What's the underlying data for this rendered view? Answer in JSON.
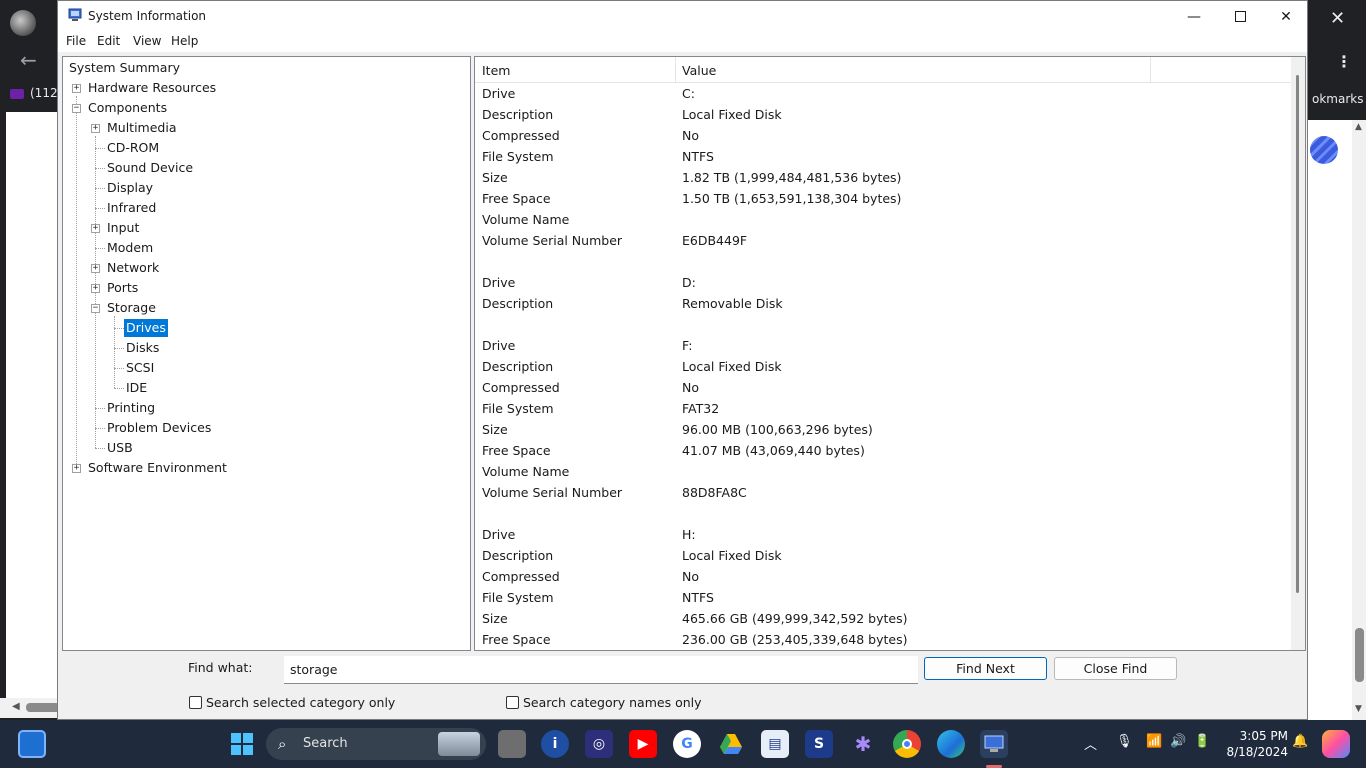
{
  "window": {
    "title": "System Information",
    "minimize": "—",
    "close": "✕"
  },
  "menu": [
    "File",
    "Edit",
    "View",
    "Help"
  ],
  "tree": {
    "system_summary": "System Summary",
    "hardware_resources": "Hardware Resources",
    "components": "Components",
    "multimedia": "Multimedia",
    "cd_rom": "CD-ROM",
    "sound_device": "Sound Device",
    "display": "Display",
    "infrared": "Infrared",
    "input": "Input",
    "modem": "Modem",
    "network": "Network",
    "ports": "Ports",
    "storage": "Storage",
    "drives": "Drives",
    "disks": "Disks",
    "scsi": "SCSI",
    "ide": "IDE",
    "printing": "Printing",
    "problem_devices": "Problem Devices",
    "usb": "USB",
    "software_environment": "Software Environment",
    "expand_sign": "+",
    "collapse_sign": "−"
  },
  "list": {
    "headers": {
      "item": "Item",
      "value": "Value"
    },
    "rows": [
      {
        "item": "Drive",
        "value": "C:"
      },
      {
        "item": "Description",
        "value": "Local Fixed Disk"
      },
      {
        "item": "Compressed",
        "value": "No"
      },
      {
        "item": "File System",
        "value": "NTFS"
      },
      {
        "item": "Size",
        "value": "1.82 TB (1,999,484,481,536 bytes)"
      },
      {
        "item": "Free Space",
        "value": "1.50 TB (1,653,591,138,304 bytes)"
      },
      {
        "item": "Volume Name",
        "value": ""
      },
      {
        "item": "Volume Serial Number",
        "value": "E6DB449F"
      },
      {
        "item": "",
        "value": ""
      },
      {
        "item": "Drive",
        "value": "D:"
      },
      {
        "item": "Description",
        "value": "Removable Disk"
      },
      {
        "item": "",
        "value": ""
      },
      {
        "item": "Drive",
        "value": "F:"
      },
      {
        "item": "Description",
        "value": "Local Fixed Disk"
      },
      {
        "item": "Compressed",
        "value": "No"
      },
      {
        "item": "File System",
        "value": "FAT32"
      },
      {
        "item": "Size",
        "value": "96.00 MB (100,663,296 bytes)"
      },
      {
        "item": "Free Space",
        "value": "41.07 MB (43,069,440 bytes)"
      },
      {
        "item": "Volume Name",
        "value": ""
      },
      {
        "item": "Volume Serial Number",
        "value": "88D8FA8C"
      },
      {
        "item": "",
        "value": ""
      },
      {
        "item": "Drive",
        "value": "H:"
      },
      {
        "item": "Description",
        "value": "Local Fixed Disk"
      },
      {
        "item": "Compressed",
        "value": "No"
      },
      {
        "item": "File System",
        "value": "NTFS"
      },
      {
        "item": "Size",
        "value": "465.66 GB (499,999,342,592 bytes)"
      },
      {
        "item": "Free Space",
        "value": "236.00 GB (253,405,339,648 bytes)"
      }
    ]
  },
  "find": {
    "label": "Find what:",
    "value": "storage",
    "find_next": "Find Next",
    "close_find": "Close Find",
    "search_selected": "Search selected category only",
    "search_names": "Search category names only"
  },
  "background": {
    "tab_text": "(112",
    "bookmarks_text": "okmarks"
  },
  "taskbar": {
    "search": "Search",
    "time": "3:05 PM",
    "date": "8/18/2024"
  },
  "colors": {
    "selection": "#0078d7",
    "taskbar": "#1f2b3d",
    "accent_button_border": "#0067c0"
  }
}
